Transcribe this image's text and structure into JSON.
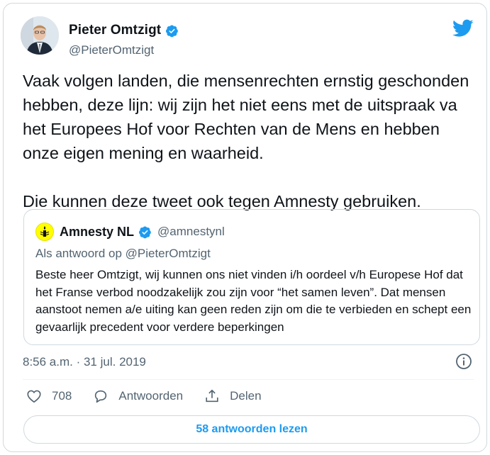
{
  "author": {
    "name": "Pieter Omtzigt",
    "handle": "@PieterOmtzigt"
  },
  "tweet": {
    "text": "Vaak volgen landen, die mensenrechten ernstig geschonden hebben, deze lijn: wij zijn het niet eens met de uitspraak va het Europees Hof voor Rechten van de Mens en hebben onze eigen mening en waarheid.\n\nDie kunnen deze tweet ook tegen Amnesty gebruiken.",
    "timestamp": "8:56 a.m. · 31 jul. 2019"
  },
  "quoted": {
    "name": "Amnesty NL",
    "handle": "@amnestynl",
    "reply_to": "Als antwoord op @PieterOmtzigt",
    "text": "Beste heer Omtzigt, wij kunnen ons niet vinden i/h oordeel v/h Europese Hof dat het Franse verbod noodzakelijk zou zijn voor “het samen leven”. Dat mensen aanstoot nemen a/e uiting kan geen reden zijn om die te verbieden en schept een gevaarlijk precedent voor verdere beperkingen"
  },
  "actions": {
    "like_count": "708",
    "reply_label": "Antwoorden",
    "share_label": "Delen",
    "read_replies_label": "58 antwoorden lezen"
  },
  "icons": {
    "verified": "verified-badge-icon",
    "twitter": "twitter-bird-icon",
    "info": "info-icon",
    "like": "heart-icon",
    "reply": "speech-bubble-icon",
    "share": "share-upload-icon",
    "amnesty": "candle-icon"
  },
  "colors": {
    "accent": "#1d9bf0",
    "secondary_text": "#536471",
    "border": "#cfd9de",
    "amnesty_yellow": "#ffff00"
  }
}
